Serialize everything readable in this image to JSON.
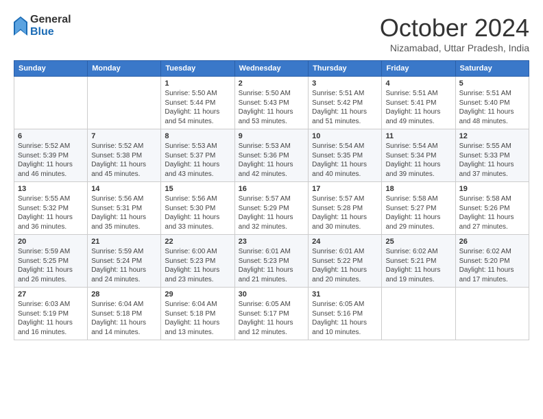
{
  "logo": {
    "general": "General",
    "blue": "Blue"
  },
  "title": "October 2024",
  "location": "Nizamabad, Uttar Pradesh, India",
  "days_of_week": [
    "Sunday",
    "Monday",
    "Tuesday",
    "Wednesday",
    "Thursday",
    "Friday",
    "Saturday"
  ],
  "weeks": [
    [
      {
        "day": "",
        "info": ""
      },
      {
        "day": "",
        "info": ""
      },
      {
        "day": "1",
        "info": "Sunrise: 5:50 AM\nSunset: 5:44 PM\nDaylight: 11 hours and 54 minutes."
      },
      {
        "day": "2",
        "info": "Sunrise: 5:50 AM\nSunset: 5:43 PM\nDaylight: 11 hours and 53 minutes."
      },
      {
        "day": "3",
        "info": "Sunrise: 5:51 AM\nSunset: 5:42 PM\nDaylight: 11 hours and 51 minutes."
      },
      {
        "day": "4",
        "info": "Sunrise: 5:51 AM\nSunset: 5:41 PM\nDaylight: 11 hours and 49 minutes."
      },
      {
        "day": "5",
        "info": "Sunrise: 5:51 AM\nSunset: 5:40 PM\nDaylight: 11 hours and 48 minutes."
      }
    ],
    [
      {
        "day": "6",
        "info": "Sunrise: 5:52 AM\nSunset: 5:39 PM\nDaylight: 11 hours and 46 minutes."
      },
      {
        "day": "7",
        "info": "Sunrise: 5:52 AM\nSunset: 5:38 PM\nDaylight: 11 hours and 45 minutes."
      },
      {
        "day": "8",
        "info": "Sunrise: 5:53 AM\nSunset: 5:37 PM\nDaylight: 11 hours and 43 minutes."
      },
      {
        "day": "9",
        "info": "Sunrise: 5:53 AM\nSunset: 5:36 PM\nDaylight: 11 hours and 42 minutes."
      },
      {
        "day": "10",
        "info": "Sunrise: 5:54 AM\nSunset: 5:35 PM\nDaylight: 11 hours and 40 minutes."
      },
      {
        "day": "11",
        "info": "Sunrise: 5:54 AM\nSunset: 5:34 PM\nDaylight: 11 hours and 39 minutes."
      },
      {
        "day": "12",
        "info": "Sunrise: 5:55 AM\nSunset: 5:33 PM\nDaylight: 11 hours and 37 minutes."
      }
    ],
    [
      {
        "day": "13",
        "info": "Sunrise: 5:55 AM\nSunset: 5:32 PM\nDaylight: 11 hours and 36 minutes."
      },
      {
        "day": "14",
        "info": "Sunrise: 5:56 AM\nSunset: 5:31 PM\nDaylight: 11 hours and 35 minutes."
      },
      {
        "day": "15",
        "info": "Sunrise: 5:56 AM\nSunset: 5:30 PM\nDaylight: 11 hours and 33 minutes."
      },
      {
        "day": "16",
        "info": "Sunrise: 5:57 AM\nSunset: 5:29 PM\nDaylight: 11 hours and 32 minutes."
      },
      {
        "day": "17",
        "info": "Sunrise: 5:57 AM\nSunset: 5:28 PM\nDaylight: 11 hours and 30 minutes."
      },
      {
        "day": "18",
        "info": "Sunrise: 5:58 AM\nSunset: 5:27 PM\nDaylight: 11 hours and 29 minutes."
      },
      {
        "day": "19",
        "info": "Sunrise: 5:58 AM\nSunset: 5:26 PM\nDaylight: 11 hours and 27 minutes."
      }
    ],
    [
      {
        "day": "20",
        "info": "Sunrise: 5:59 AM\nSunset: 5:25 PM\nDaylight: 11 hours and 26 minutes."
      },
      {
        "day": "21",
        "info": "Sunrise: 5:59 AM\nSunset: 5:24 PM\nDaylight: 11 hours and 24 minutes."
      },
      {
        "day": "22",
        "info": "Sunrise: 6:00 AM\nSunset: 5:23 PM\nDaylight: 11 hours and 23 minutes."
      },
      {
        "day": "23",
        "info": "Sunrise: 6:01 AM\nSunset: 5:23 PM\nDaylight: 11 hours and 21 minutes."
      },
      {
        "day": "24",
        "info": "Sunrise: 6:01 AM\nSunset: 5:22 PM\nDaylight: 11 hours and 20 minutes."
      },
      {
        "day": "25",
        "info": "Sunrise: 6:02 AM\nSunset: 5:21 PM\nDaylight: 11 hours and 19 minutes."
      },
      {
        "day": "26",
        "info": "Sunrise: 6:02 AM\nSunset: 5:20 PM\nDaylight: 11 hours and 17 minutes."
      }
    ],
    [
      {
        "day": "27",
        "info": "Sunrise: 6:03 AM\nSunset: 5:19 PM\nDaylight: 11 hours and 16 minutes."
      },
      {
        "day": "28",
        "info": "Sunrise: 6:04 AM\nSunset: 5:18 PM\nDaylight: 11 hours and 14 minutes."
      },
      {
        "day": "29",
        "info": "Sunrise: 6:04 AM\nSunset: 5:18 PM\nDaylight: 11 hours and 13 minutes."
      },
      {
        "day": "30",
        "info": "Sunrise: 6:05 AM\nSunset: 5:17 PM\nDaylight: 11 hours and 12 minutes."
      },
      {
        "day": "31",
        "info": "Sunrise: 6:05 AM\nSunset: 5:16 PM\nDaylight: 11 hours and 10 minutes."
      },
      {
        "day": "",
        "info": ""
      },
      {
        "day": "",
        "info": ""
      }
    ]
  ]
}
